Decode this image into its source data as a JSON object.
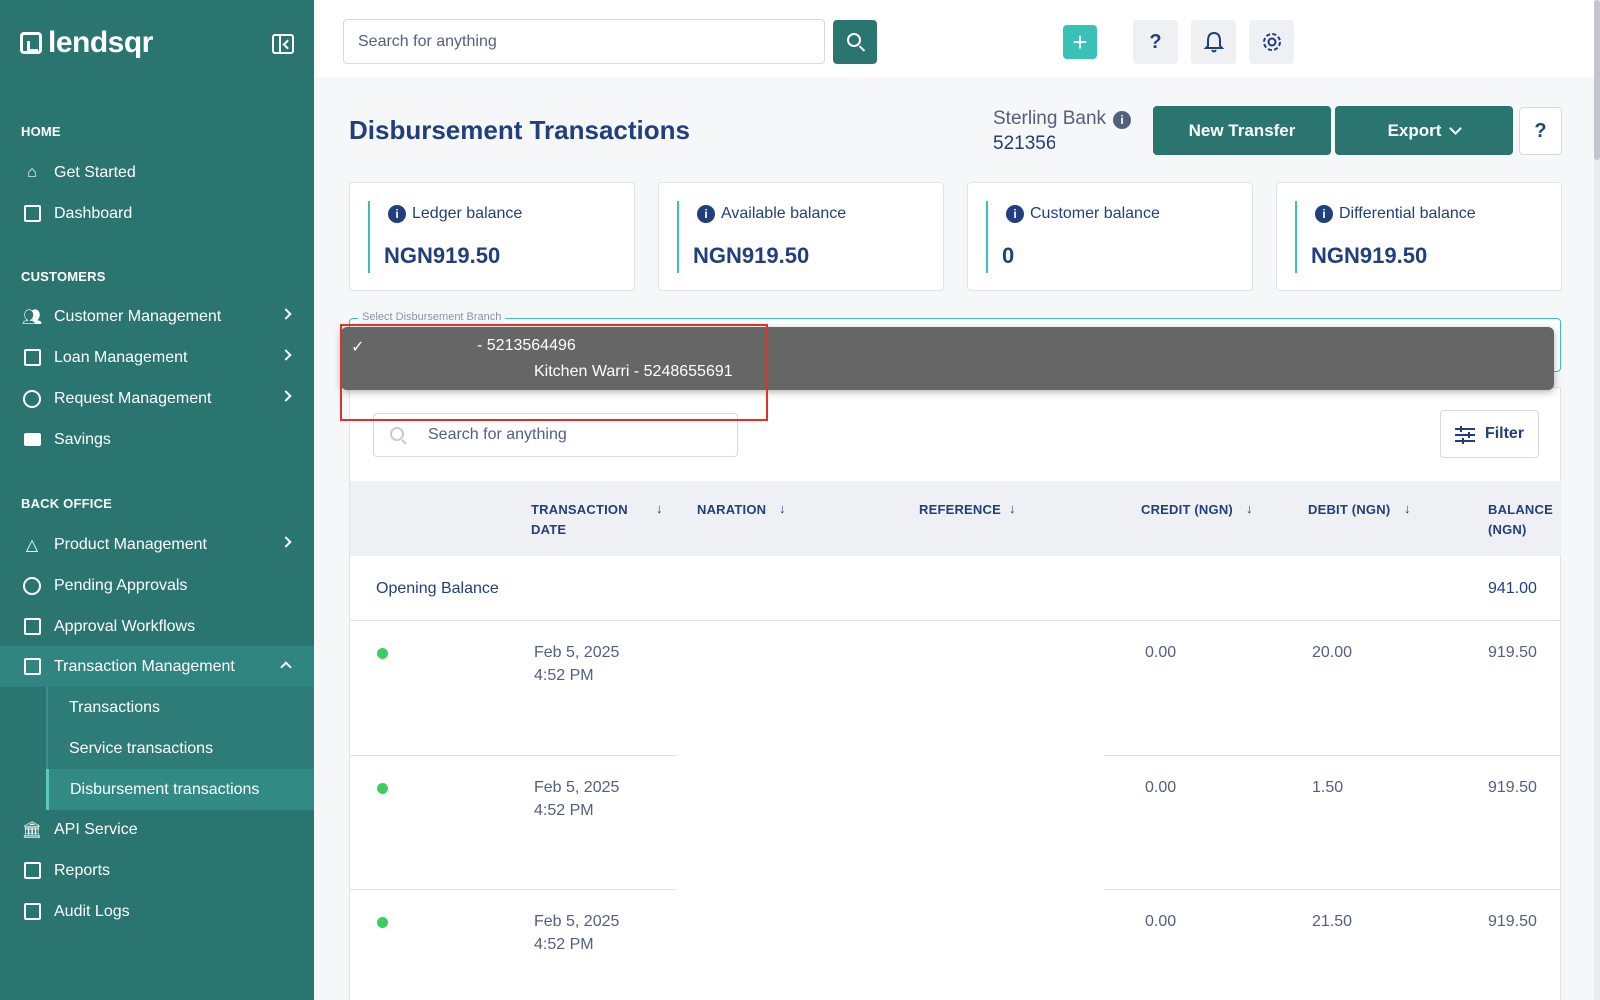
{
  "app": {
    "logo_text": "lendsqr"
  },
  "sidebar": {
    "sections": {
      "home": "HOME",
      "customers": "CUSTOMERS",
      "back_office": "BACK OFFICE"
    },
    "items": {
      "get_started": "Get Started",
      "dashboard": "Dashboard",
      "customer_management": "Customer Management",
      "loan_management": "Loan Management",
      "request_management": "Request Management",
      "savings": "Savings",
      "product_management": "Product Management",
      "pending_approvals": "Pending Approvals",
      "approval_workflows": "Approval Workflows",
      "transaction_management": "Transaction Management",
      "transactions": "Transactions",
      "service_transactions": "Service transactions",
      "disbursement_transactions": "Disbursement transactions",
      "api_service": "API Service",
      "reports": "Reports",
      "audit_logs": "Audit Logs"
    }
  },
  "topbar": {
    "search_placeholder": "Search for anything",
    "plus_label": "+",
    "help_label": "?"
  },
  "page": {
    "title": "Disbursement Transactions",
    "bank_name": "Sterling Bank",
    "bank_account": "521356",
    "new_transfer_label": "New Transfer",
    "export_label": "Export",
    "help_label": "?"
  },
  "cards": [
    {
      "label": "Ledger balance",
      "value": "NGN919.50"
    },
    {
      "label": "Available balance",
      "value": "NGN919.50"
    },
    {
      "label": "Customer balance",
      "value": "0"
    },
    {
      "label": "Differential balance",
      "value": "NGN919.50"
    }
  ],
  "branch_select": {
    "legend": "Select Disbursement Branch",
    "options": [
      {
        "label": "- 5213564496",
        "selected": true
      },
      {
        "label": "Kitchen Warri - 5248655691",
        "selected": false
      }
    ],
    "check": "✓"
  },
  "table": {
    "search_placeholder": "Search for anything",
    "filter_label": "Filter",
    "headers": {
      "transaction_date": [
        "TRANSACTION",
        "DATE"
      ],
      "naration": "NARATION",
      "reference": "REFERENCE",
      "credit": "CREDIT (NGN)",
      "debit": "DEBIT (NGN)",
      "balance": [
        "BALANCE",
        "(NGN)"
      ]
    },
    "sort_glyph": "↓",
    "opening": {
      "label": "Opening Balance",
      "balance": "941.00"
    },
    "rows": [
      {
        "date": "Feb 5, 2025",
        "time": "4:52 PM",
        "credit": "0.00",
        "debit": "20.00",
        "balance": "919.50"
      },
      {
        "date": "Feb 5, 2025",
        "time": "4:52 PM",
        "credit": "0.00",
        "debit": "1.50",
        "balance": "919.50"
      },
      {
        "date": "Feb 5, 2025",
        "time": "4:52 PM",
        "credit": "0.00",
        "debit": "21.50",
        "balance": "919.50"
      }
    ]
  },
  "colors": {
    "sidebar": "#2b7571",
    "accent": "#39c1b8",
    "text": "#213f7d",
    "status_dot": "#39cd62",
    "highlight": "#e0302a"
  }
}
